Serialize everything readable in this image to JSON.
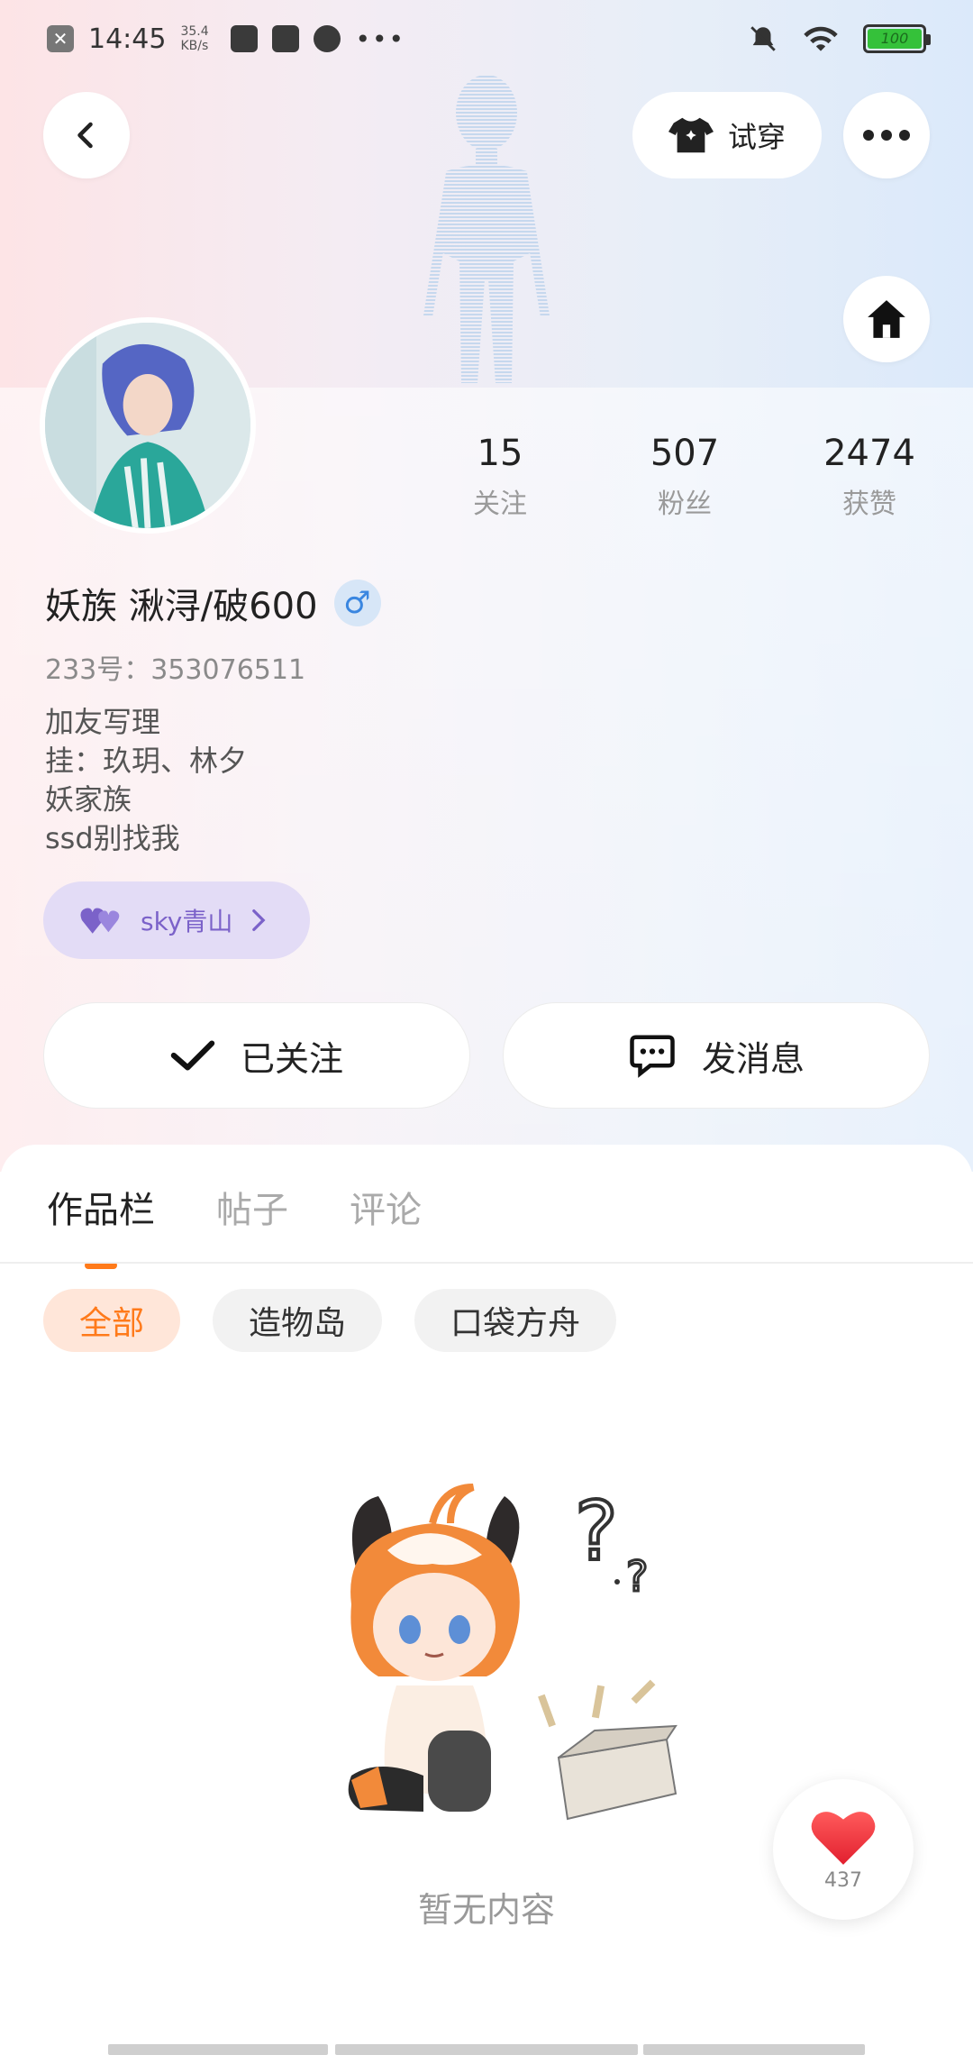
{
  "status_bar": {
    "time": "14:45",
    "net_speed_value": "35.4",
    "net_speed_unit": "KB/s",
    "battery": "100"
  },
  "header": {
    "try_on_label": "试穿"
  },
  "profile": {
    "name": "妖族 湫浔/破600",
    "uid": "233号：353076511",
    "bio": [
      "加友写理",
      "挂：玖玥、林夕",
      "妖家族",
      "ssd别找我"
    ],
    "tag_label": "sky青山",
    "stats": [
      {
        "value": "15",
        "label": "关注"
      },
      {
        "value": "507",
        "label": "粉丝"
      },
      {
        "value": "2474",
        "label": "获赞"
      }
    ]
  },
  "actions": {
    "follow_label": "已关注",
    "message_label": "发消息"
  },
  "tabs": [
    {
      "label": "作品栏"
    },
    {
      "label": "帖子"
    },
    {
      "label": "评论"
    }
  ],
  "filters": [
    {
      "label": "全部"
    },
    {
      "label": "造物岛"
    },
    {
      "label": "口袋方舟"
    }
  ],
  "empty_state": {
    "text": "暂无内容"
  },
  "like_fab": {
    "count": "437"
  },
  "colors": {
    "accent": "#ff7a1a",
    "gender_blue": "#3a86e0",
    "tag_purple": "#7b62c9",
    "like_red": "#f23b3b"
  }
}
